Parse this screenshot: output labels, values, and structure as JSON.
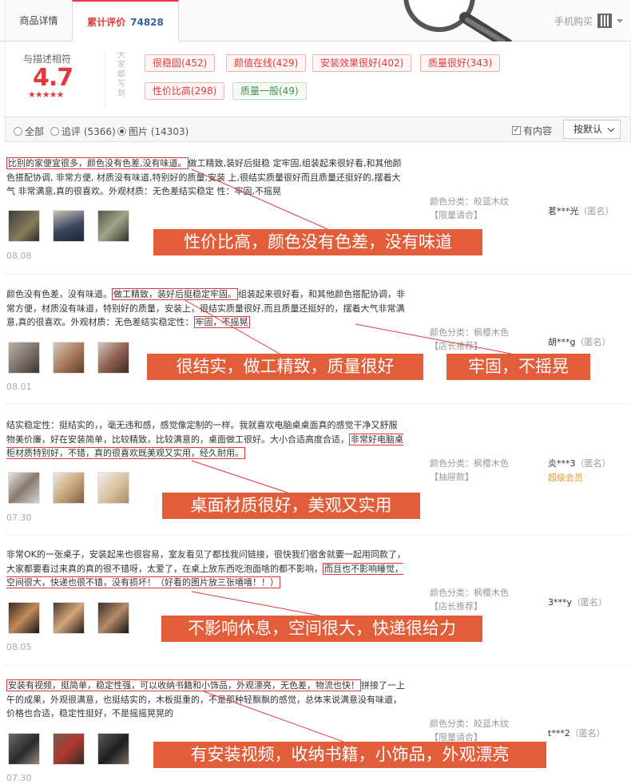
{
  "tabs": {
    "detail": "商品详情",
    "reviews": "累计评价",
    "reviews_count": "74828"
  },
  "mobile_buy": "手机购买",
  "summary": {
    "label": "与描述相符",
    "score": "4.7",
    "stars": "★★★★★",
    "vertical_note": "大家都写到",
    "tags": [
      {
        "text": "很稳固(452)",
        "color": "red"
      },
      {
        "text": "颜值在线(429)",
        "color": "red"
      },
      {
        "text": "安装效果很好(402)",
        "color": "red"
      },
      {
        "text": "质量很好(343)",
        "color": "red"
      },
      {
        "text": "性价比高(298)",
        "color": "red"
      },
      {
        "text": "质量一般(49)",
        "color": "green"
      }
    ]
  },
  "filter": {
    "all": "全部",
    "append": "追评 (5366)",
    "images": "图片 (14303)",
    "has_content": "有内容",
    "sort": "按默认"
  },
  "reviews": [
    {
      "pre": "",
      "hl1": "比别的家便宜很多，颜色没有色差,没有味道。",
      "mid": "做工精致,装好后挺稳 定牢固,组装起来很好看,和其他颜色搭配协调, 非常方便, 材质没有味道,特别好的质量,安装 上,很结实质量很好而且质量还挺好的,摆着大气 非常满意,真的很喜欢。外观材质：无色差结实稳定 性：牢固,不摇晃",
      "hl2": "",
      "post": "",
      "date": "08.08",
      "meta_label": "颜色分类：",
      "meta_value": "皎蓝木纹【限量请合】",
      "user": "茗***光",
      "anon": "（匿名）",
      "vip": "",
      "banners": [
        "性价比高，颜色没有色差，没有味道"
      ]
    },
    {
      "pre": "颜色没有色差，没有味道。",
      "hl1": "做工精致，装好后挺稳定牢固。",
      "mid": "组装起来很好看，和其他颜色搭配协调，非常方便，材质没有味道，特别好的质量，安装上，很结实质量很好,而且质量还挺好的，摆着大气非常满意,真的很喜欢。外观材质：无色差结实稳定性：",
      "hl2": "牢固，不摇晃",
      "post": "",
      "date": "08.01",
      "meta_label": "颜色分类：",
      "meta_value": "枫樱木色【店长推荐】",
      "user": "胡***g",
      "anon": "（匿名）",
      "vip": "",
      "banners": [
        "很结实，做工精致，质量很好",
        "牢固，不摇晃"
      ]
    },
    {
      "pre": "结实稳定性：挺结实的，，毫无违和感，感觉像定制的一样。我就喜欢电脑桌桌面真的感觉干净又舒服物美价廉，好在安装简单，比较精致，比较满意的，桌面做工很好。大小合适高度合适，",
      "hl1": "非常好电脑桌柜材质特别好，不错，真的很喜欢既美观又实用，经久耐用。",
      "mid": "",
      "hl2": "",
      "post": "",
      "date": "07.30",
      "meta_label": "颜色分类：",
      "meta_value": "枫樱木色【抽屉款】",
      "user": "炎***3",
      "anon": "（匿名）",
      "vip": "超级会员",
      "banners": [
        "桌面材质很好，美观又实用"
      ]
    },
    {
      "pre": "非常OK的一张桌子，安装起来也很容易，室友看见了都找我问链接，很快我们宿舍就要一起用同款了，大家都要看过来真的真的很不错呀，太爱了，在桌上放东西吃泡面啥的都不影响，",
      "hl1": "而且也不影响睡觉，空间很大，快递也很不错，没有损坏！（好看的图片放三张嘻嘻！！）",
      "mid": "",
      "hl2": "",
      "post": "",
      "date": "08.05",
      "meta_label": "颜色分类：",
      "meta_value": "枫樱木色【店长推荐】",
      "user": "3***y",
      "anon": "（匿名）",
      "vip": "",
      "banners": [
        "不影响休息，空间很大，快递很给力"
      ]
    },
    {
      "pre": "",
      "hl1": "安装有视频，挺简单，稳定性强，可以收纳书籍和小饰品，外观漂亮，无色差，物流也快！",
      "mid": "拼接了一上午的成果，外观很满意，也挺结实的，木板挺重的，不是那种轻飘飘的感觉，总体来说满意没有味道，价格也合适，稳定性挺好，不是摇摇晃晃的",
      "hl2": "",
      "post": "",
      "date": "07.30",
      "meta_label": "颜色分类：",
      "meta_value": "皎蓝木纹【限量请合】",
      "user": "t***2",
      "anon": "（匿名）",
      "vip": "",
      "banners": [
        "有安装视频，收纳书籍，小饰品，外观漂亮"
      ]
    }
  ]
}
